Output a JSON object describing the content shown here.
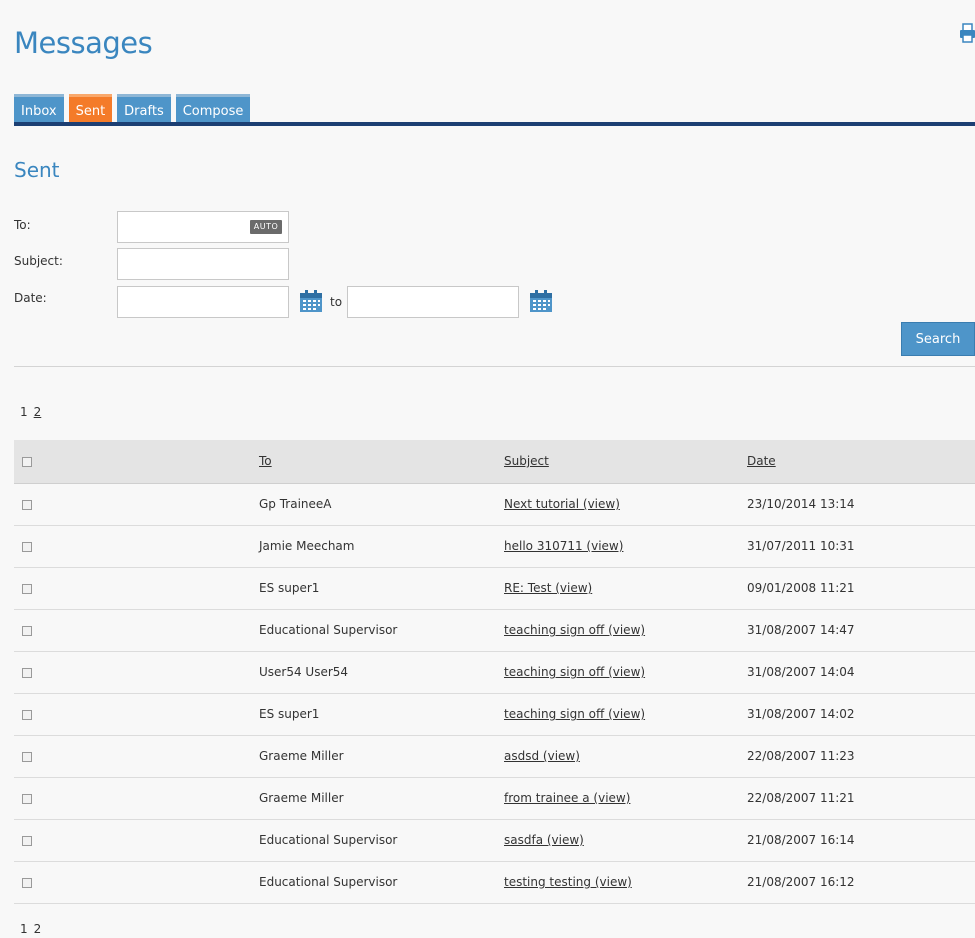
{
  "header": {
    "title": "Messages",
    "print_icon": "printer-icon"
  },
  "tabs": [
    {
      "label": "Inbox",
      "active": false
    },
    {
      "label": "Sent",
      "active": true
    },
    {
      "label": "Drafts",
      "active": false
    },
    {
      "label": "Compose",
      "active": false
    }
  ],
  "section": {
    "title": "Sent"
  },
  "filters": {
    "to_label": "To:",
    "to_value": "",
    "auto_badge": "AUTO",
    "subject_label": "Subject:",
    "subject_value": "",
    "date_label": "Date:",
    "date_from_value": "",
    "date_to_word": "to",
    "date_to_value": "",
    "calendar_icon": "calendar-icon",
    "search_label": "Search"
  },
  "pagination": {
    "pages": [
      "1",
      "2"
    ],
    "current": "1"
  },
  "table": {
    "columns": [
      "To",
      "Subject",
      "Date"
    ],
    "rows": [
      {
        "to": "Gp TraineeA",
        "subject": "Next tutorial (view)",
        "date": "23/10/2014 13:14"
      },
      {
        "to": "Jamie Meecham",
        "subject": "hello 310711 (view)",
        "date": "31/07/2011 10:31"
      },
      {
        "to": "ES super1",
        "subject": "RE: Test (view)",
        "date": "09/01/2008 11:21"
      },
      {
        "to": "Educational Supervisor",
        "subject": "teaching sign off (view)",
        "date": "31/08/2007 14:47"
      },
      {
        "to": "User54 User54",
        "subject": "teaching sign off (view)",
        "date": "31/08/2007 14:04"
      },
      {
        "to": "ES super1",
        "subject": "teaching sign off (view)",
        "date": "31/08/2007 14:02"
      },
      {
        "to": "Graeme Miller",
        "subject": "asdsd (view)",
        "date": "22/08/2007 11:23"
      },
      {
        "to": "Graeme Miller",
        "subject": "from trainee a (view)",
        "date": "22/08/2007 11:21"
      },
      {
        "to": "Educational Supervisor",
        "subject": "sasdfa (view)",
        "date": "21/08/2007 16:14"
      },
      {
        "to": "Educational Supervisor",
        "subject": "testing testing (view)",
        "date": "21/08/2007 16:12"
      }
    ]
  },
  "colors": {
    "accent": "#3a86bf",
    "tab": "#4e95c9",
    "tab_active": "#f47b29",
    "rule": "#1c3f73"
  }
}
